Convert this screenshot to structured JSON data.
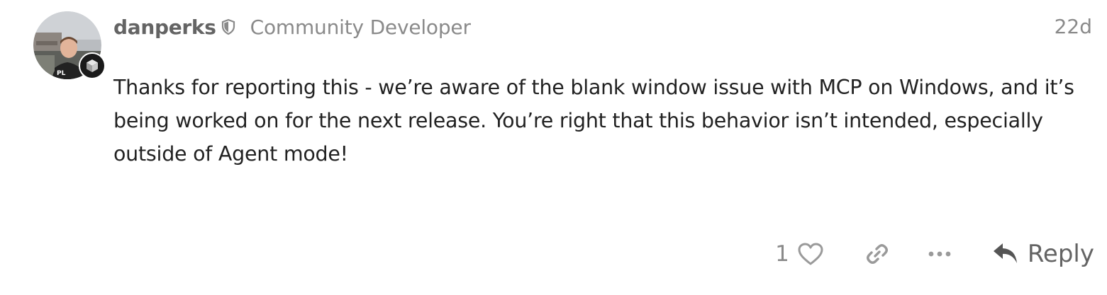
{
  "post": {
    "username": "danperks",
    "user_title": "Community Developer",
    "date": "22d",
    "avatar_icon": "user-avatar",
    "flair_icon": "cube-icon",
    "moderator_icon": "shield-icon",
    "body_text": "Thanks for reporting this - we’re aware of the blank window issue with MCP on Windows, and it’s being worked on for the next release. You’re right that this behavior isn’t intended, especially outside of Agent mode!"
  },
  "actions": {
    "like_count": "1",
    "like_icon": "heart-icon",
    "link_icon": "link-icon",
    "more_icon": "ellipsis-icon",
    "reply_icon": "reply-arrow-icon",
    "reply_label": "Reply"
  },
  "colors": {
    "username": "#646464",
    "muted": "#8a8a8a",
    "text": "#222222",
    "icon": "#9a9a9a"
  }
}
